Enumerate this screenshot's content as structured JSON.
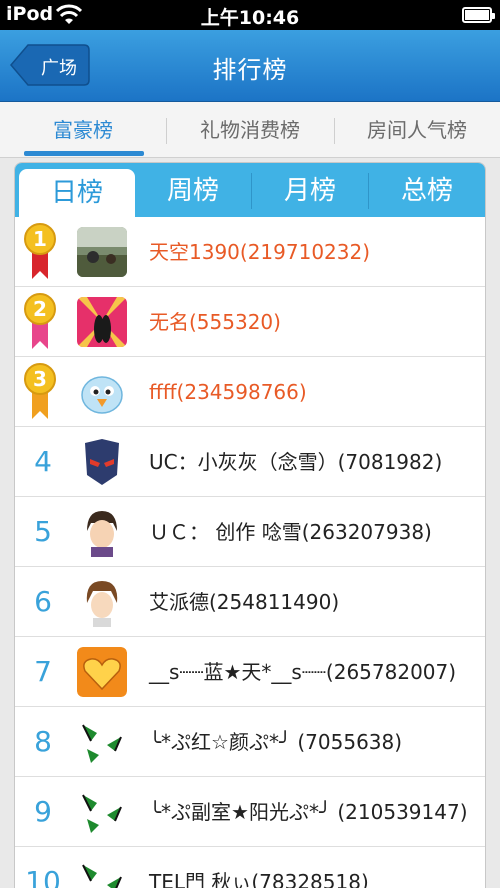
{
  "status": {
    "carrier": "iPod",
    "time": "上午10:46"
  },
  "navbar": {
    "back_label": "广场",
    "title": "排行榜"
  },
  "category_tabs": [
    {
      "label": "富豪榜",
      "active": true
    },
    {
      "label": "礼物消费榜",
      "active": false
    },
    {
      "label": "房间人气榜",
      "active": false
    }
  ],
  "period_tabs": [
    {
      "label": "日榜",
      "active": true
    },
    {
      "label": "周榜",
      "active": false
    },
    {
      "label": "月榜",
      "active": false
    },
    {
      "label": "总榜",
      "active": false
    }
  ],
  "rankings": [
    {
      "rank": "1",
      "medal": "gold-medal",
      "name": "天空1390(219710232)",
      "avatar": "landscape-photo"
    },
    {
      "rank": "2",
      "medal": "silver-medal",
      "name": "无名(555320)",
      "avatar": "couple-sunset"
    },
    {
      "rank": "3",
      "medal": "bronze-medal",
      "name": "ffff(234598766)",
      "avatar": "cartoon-bird"
    },
    {
      "rank": "4",
      "name": "UC：小灰灰（念雪）(7081982)",
      "avatar": "masked-hero"
    },
    {
      "rank": "5",
      "name": "ＵＣ： 创作 唸雪(263207938)",
      "avatar": "anime-boy"
    },
    {
      "rank": "6",
      "name": "艾派德(254811490)",
      "avatar": "anime-boy-2"
    },
    {
      "rank": "7",
      "name": "__s┈┈蓝★天*__s┈┈(265782007)",
      "avatar": "golden-heart"
    },
    {
      "rank": "8",
      "name": "╰*ぷ红☆颜ぷ*╯ (7055638)",
      "avatar": "butterflies"
    },
    {
      "rank": "9",
      "name": "╰*ぷ副室★阳光ぷ*╯ (210539147)",
      "avatar": "butterflies"
    },
    {
      "rank": "10",
      "name": "TEL門     秋ぃ(78328518)",
      "avatar": "butterflies"
    }
  ],
  "colors": {
    "accent": "#2d8ad3",
    "period_bar": "#40b2e5",
    "top3_name": "#e85a26",
    "rank_number": "#39a2da"
  }
}
